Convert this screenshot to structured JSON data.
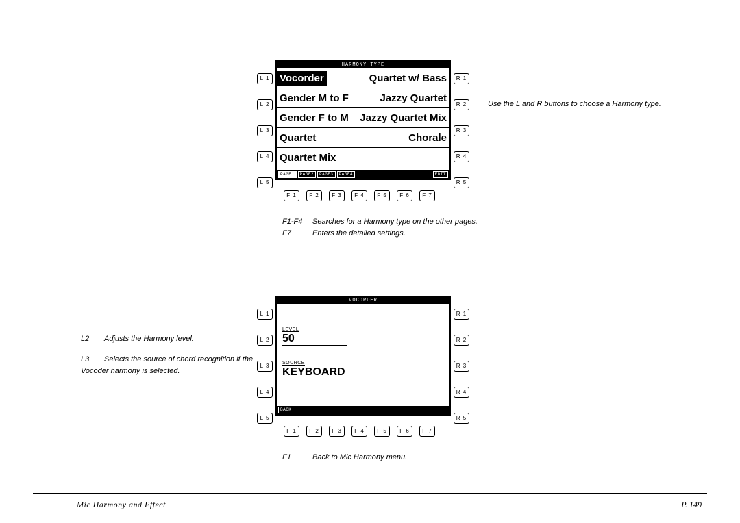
{
  "footer": {
    "title": "Mic Harmony and Effect",
    "page": "P. 149"
  },
  "screen1": {
    "title": "HARMONY TYPE",
    "rows": [
      {
        "left": "Vocorder",
        "right": "Quartet w/ Bass"
      },
      {
        "left": "Gender M to F",
        "right": "Jazzy Quartet"
      },
      {
        "left": "Gender F to M",
        "right": "Jazzy Quartet Mix"
      },
      {
        "left": "Quartet",
        "right": "Chorale"
      },
      {
        "left": "Quartet Mix",
        "right": ""
      }
    ],
    "selected_index": 0,
    "tabs": [
      "PAGE1",
      "PAGE2",
      "PAGE3",
      "PAGE4"
    ],
    "tab_right": "EDIT",
    "L": [
      "L 1",
      "L 2",
      "L 3",
      "L 4",
      "L 5"
    ],
    "R": [
      "R 1",
      "R 2",
      "R 3",
      "R 4",
      "R 5"
    ],
    "F": [
      "F 1",
      "F 2",
      "F 3",
      "F 4",
      "F 5",
      "F 6",
      "F 7"
    ],
    "cap_right": "Use the L and R buttons to choose a Harmony type.",
    "cap_under": [
      {
        "k": "F1-F4",
        "t": "Searches for a Harmony type on the other pages."
      },
      {
        "k": "F7",
        "t": "Enters the detailed settings."
      }
    ]
  },
  "screen2": {
    "title": "VOCORDER",
    "level_label": "LEVEL",
    "level_value": "50",
    "source_label": "SOURCE",
    "source_value": "KEYBOARD",
    "tab_left": "BACK",
    "L": [
      "L 1",
      "L 2",
      "L 3",
      "L 4",
      "L 5"
    ],
    "R": [
      "R 1",
      "R 2",
      "R 3",
      "R 4",
      "R 5"
    ],
    "F": [
      "F 1",
      "F 2",
      "F 3",
      "F 4",
      "F 5",
      "F 6",
      "F 7"
    ],
    "cap_left": [
      {
        "k": "L2",
        "t": "Adjusts the Harmony level."
      },
      {
        "k": "L3",
        "t": "Selects the source of chord recognition if the Vocoder harmony is selected."
      }
    ],
    "cap_under": [
      {
        "k": "F1",
        "t": "Back to Mic Harmony menu."
      }
    ]
  }
}
